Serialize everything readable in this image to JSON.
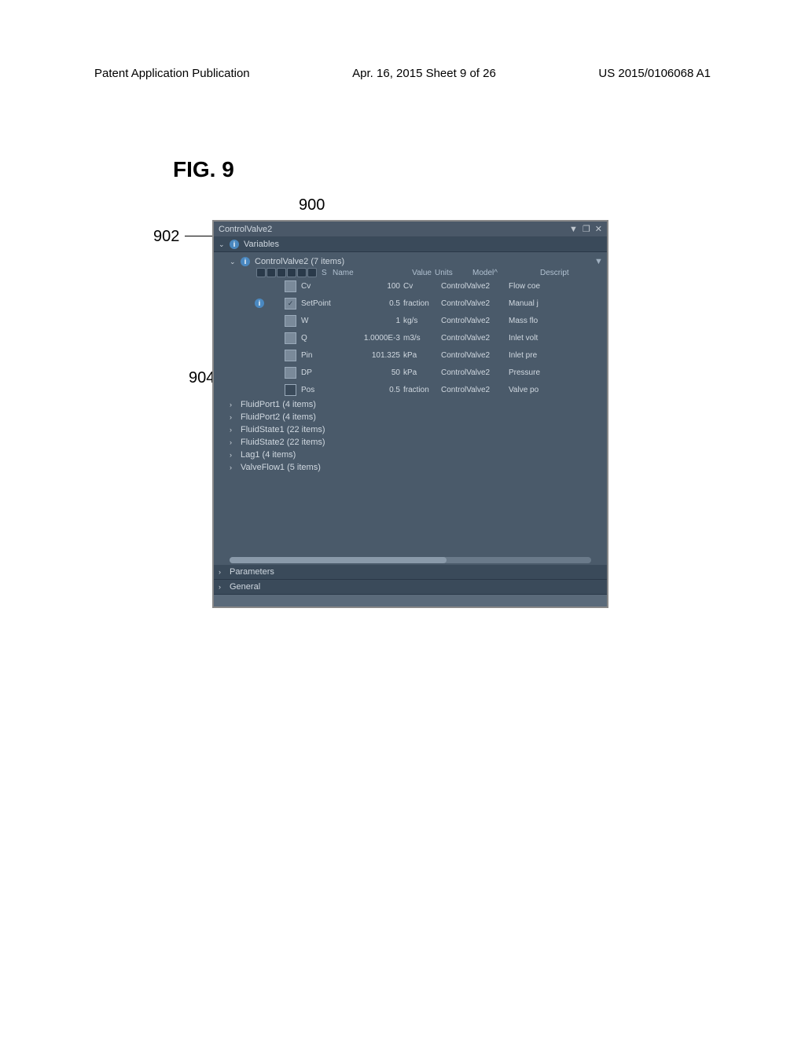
{
  "page_header": {
    "left": "Patent Application Publication",
    "center": "Apr. 16, 2015  Sheet 9 of 26",
    "right": "US 2015/0106068 A1"
  },
  "figure_label": "FIG. 9",
  "refs": {
    "r900": "900",
    "r902": "902",
    "r904": "904"
  },
  "panel": {
    "title": "ControlValve2",
    "sections": {
      "variables": {
        "label": "Variables",
        "expanded_node": "ControlValve2 (7 items)",
        "columns": {
          "s": "S",
          "name": "Name",
          "value": "Value",
          "units": "Units",
          "model": "Model^",
          "descript": "Descript"
        },
        "rows": [
          {
            "checked": false,
            "name": "Cv",
            "value": "100",
            "units": "Cv",
            "model": "ControlValve2",
            "desc": "Flow coe"
          },
          {
            "checked": true,
            "name": "SetPoint",
            "value": "0.5",
            "units": "fraction",
            "model": "ControlValve2",
            "desc": "Manual j",
            "has_info": true
          },
          {
            "checked": false,
            "name": "W",
            "value": "1",
            "units": "kg/s",
            "model": "ControlValve2",
            "desc": "Mass flo"
          },
          {
            "checked": false,
            "name": "Q",
            "value": "1.0000E-3",
            "units": "m3/s",
            "model": "ControlValve2",
            "desc": "Inlet volt"
          },
          {
            "checked": false,
            "name": "Pin",
            "value": "101.325",
            "units": "kPa",
            "model": "ControlValve2",
            "desc": "Inlet pre"
          },
          {
            "checked": false,
            "name": "DP",
            "value": "50",
            "units": "kPa",
            "model": "ControlValve2",
            "desc": "Pressure"
          },
          {
            "checked": false,
            "filled": true,
            "name": "Pos",
            "value": "0.5",
            "units": "fraction",
            "model": "ControlValve2",
            "desc": "Valve po"
          }
        ],
        "collapsed_nodes": [
          "FluidPort1 (4 items)",
          "FluidPort2 (4 items)",
          "FluidState1 (22 items)",
          "FluidState2 (22 items)",
          "Lag1 (4 items)",
          "ValveFlow1 (5 items)"
        ]
      },
      "parameters": "Parameters",
      "general": "General"
    }
  }
}
